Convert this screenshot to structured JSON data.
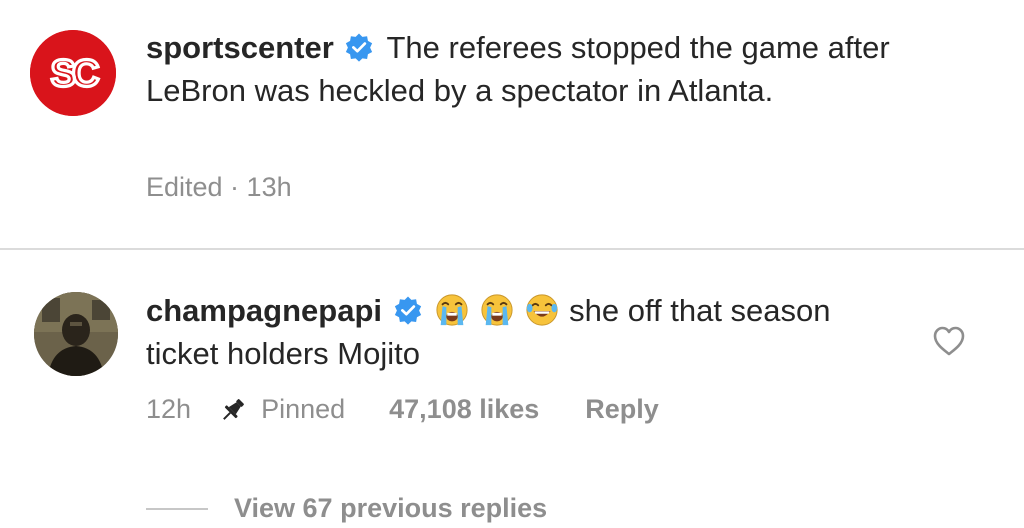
{
  "post": {
    "username": "sportscenter",
    "caption": "The referees stopped the game after LeBron was heckled by a spectator in Atlanta.",
    "meta": "Edited · 13h",
    "avatar_text": "SC",
    "avatar_color": "#d9141b"
  },
  "comment": {
    "username": "champagnepapi",
    "emojis": [
      "loudly-crying-face",
      "loudly-crying-face",
      "face-with-tears-of-joy"
    ],
    "text": " she off that season ticket holders Mojito",
    "time": "12h",
    "pinned_label": "Pinned",
    "likes": "47,108 likes",
    "reply_label": "Reply"
  },
  "replies": {
    "view_label": "View 67 previous replies"
  },
  "colors": {
    "text": "#262626",
    "muted": "#8e8e8e",
    "verified": "#3897f0",
    "divider": "#dbdbdb"
  }
}
